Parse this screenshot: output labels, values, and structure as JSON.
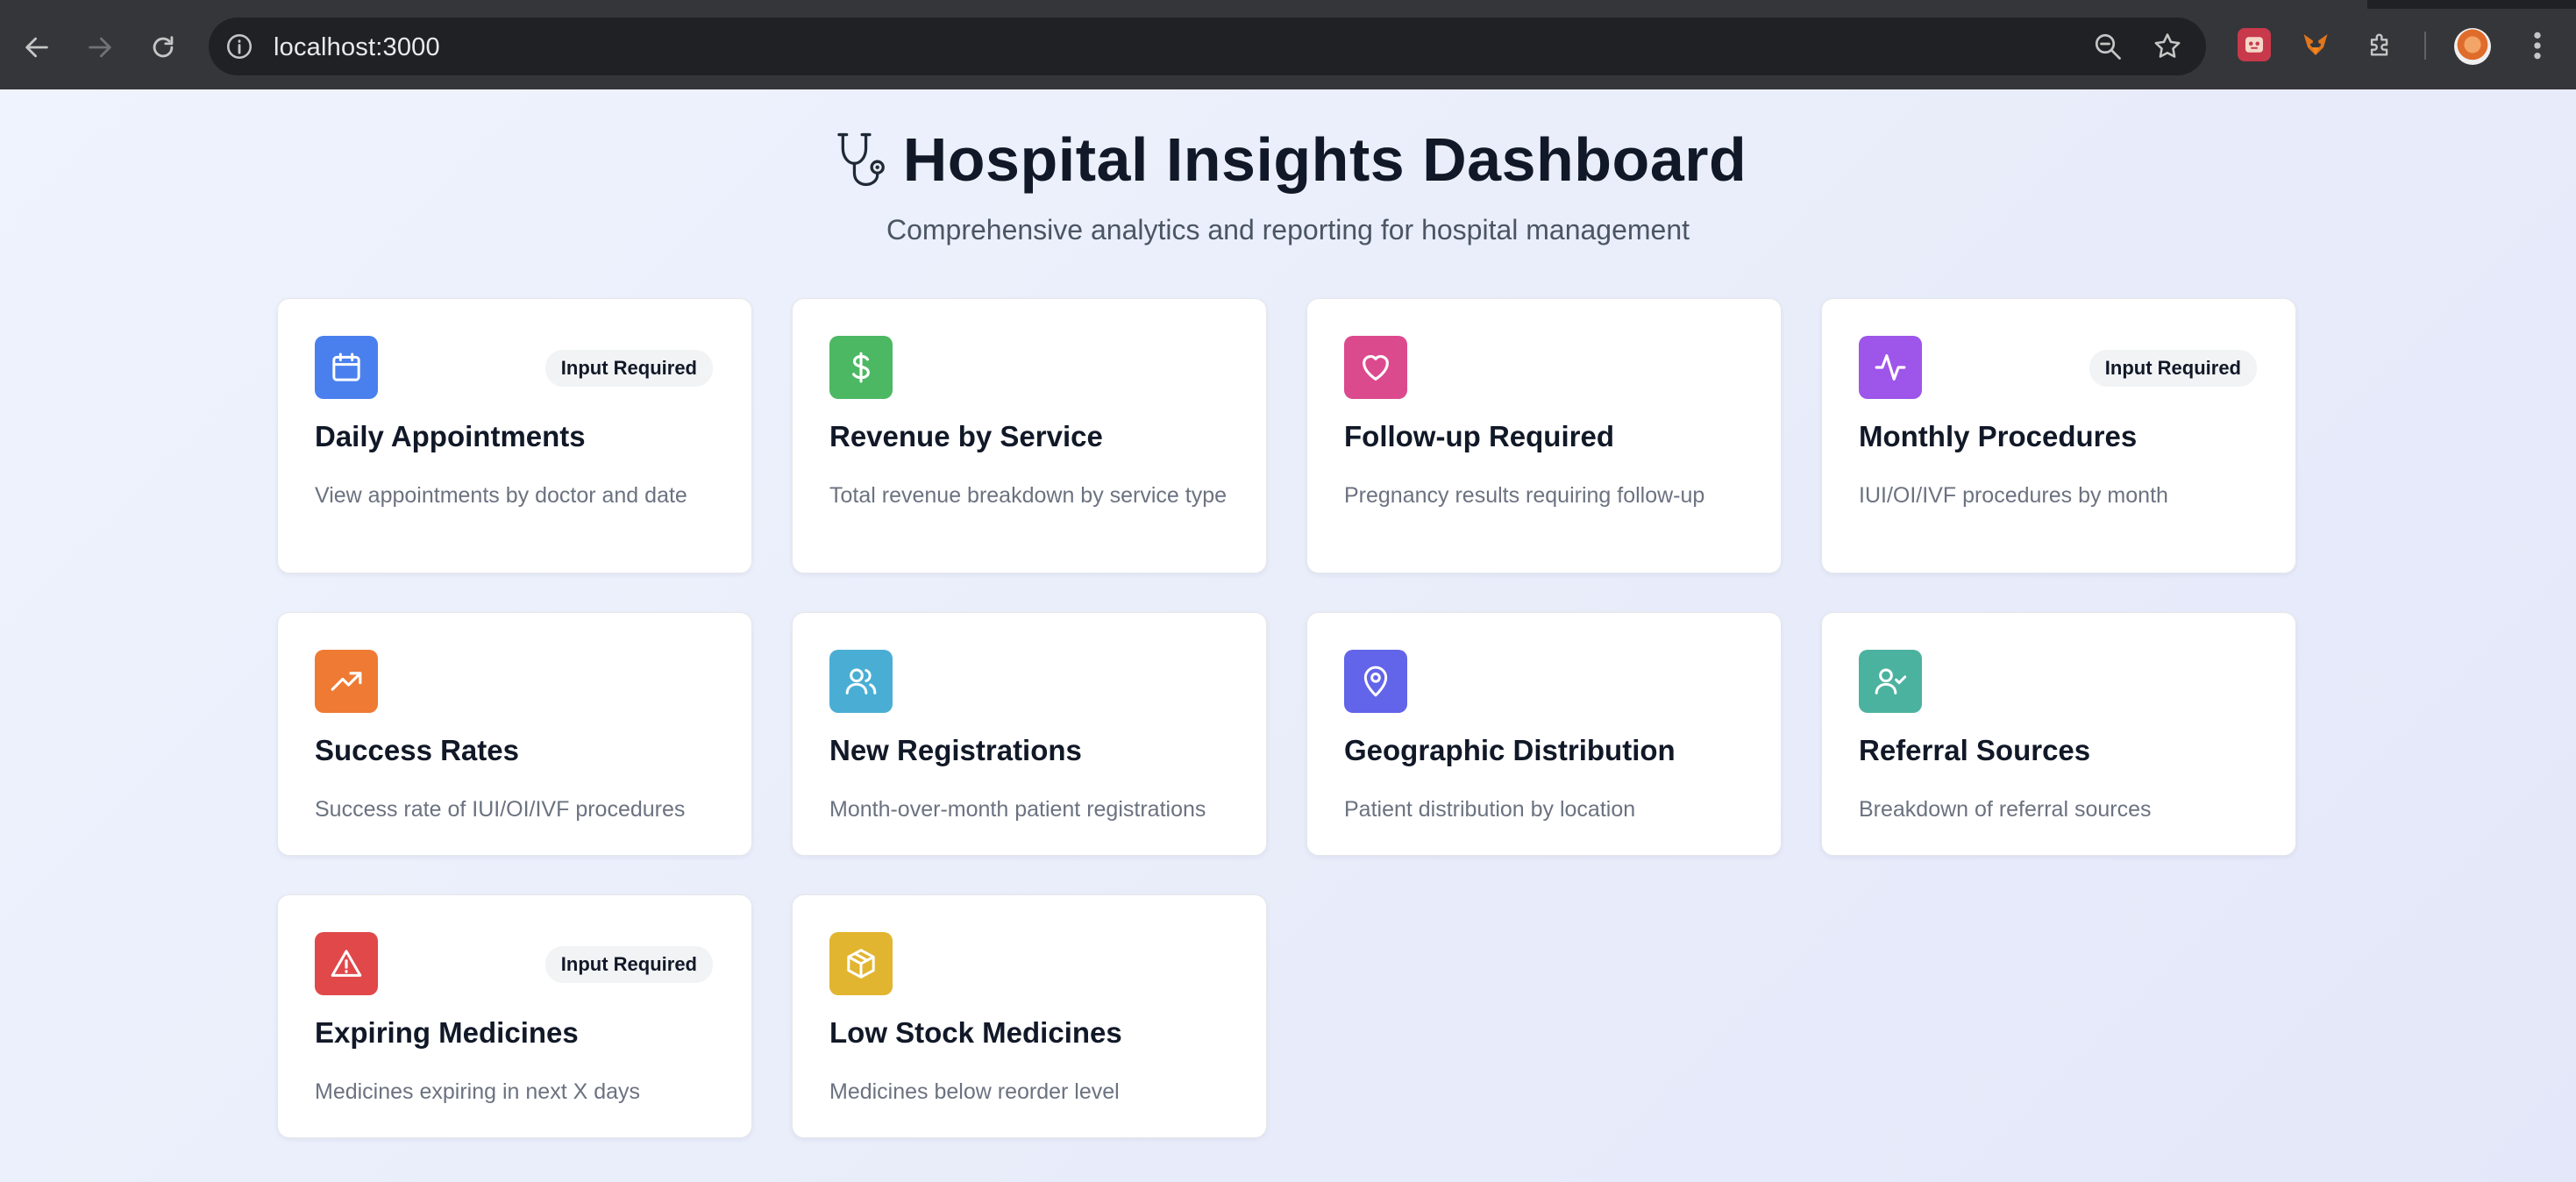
{
  "browser": {
    "url": "localhost:3000"
  },
  "header": {
    "title": "Hospital Insights Dashboard",
    "subtitle": "Comprehensive analytics and reporting for hospital management"
  },
  "cards": [
    {
      "title": "Daily Appointments",
      "description": "View appointments by doctor and date",
      "badge": "Input Required",
      "icon": "calendar-icon",
      "color": "#4a80ee"
    },
    {
      "title": "Revenue by Service",
      "description": "Total revenue breakdown by service type",
      "badge": "",
      "icon": "dollar-icon",
      "color": "#4cb863"
    },
    {
      "title": "Follow-up Required",
      "description": "Pregnancy results requiring follow-up",
      "badge": "",
      "icon": "heart-icon",
      "color": "#dc4a8e"
    },
    {
      "title": "Monthly Procedures",
      "description": "IUI/OI/IVF procedures by month",
      "badge": "Input Required",
      "icon": "activity-icon",
      "color": "#9e55ea"
    },
    {
      "title": "Success Rates",
      "description": "Success rate of IUI/OI/IVF procedures",
      "badge": "",
      "icon": "trending-up-icon",
      "color": "#ee7a33"
    },
    {
      "title": "New Registrations",
      "description": "Month-over-month patient registrations",
      "badge": "",
      "icon": "users-icon",
      "color": "#4aaed4"
    },
    {
      "title": "Geographic Distribution",
      "description": "Patient distribution by location",
      "badge": "",
      "icon": "map-pin-icon",
      "color": "#6264e9"
    },
    {
      "title": "Referral Sources",
      "description": "Breakdown of referral sources",
      "badge": "",
      "icon": "user-check-icon",
      "color": "#4cb2a0"
    },
    {
      "title": "Expiring Medicines",
      "description": "Medicines expiring in next X days",
      "badge": "Input Required",
      "icon": "alert-triangle-icon",
      "color": "#e0484a"
    },
    {
      "title": "Low Stock Medicines",
      "description": "Medicines below reorder level",
      "badge": "",
      "icon": "package-icon",
      "color": "#e2b530"
    }
  ]
}
